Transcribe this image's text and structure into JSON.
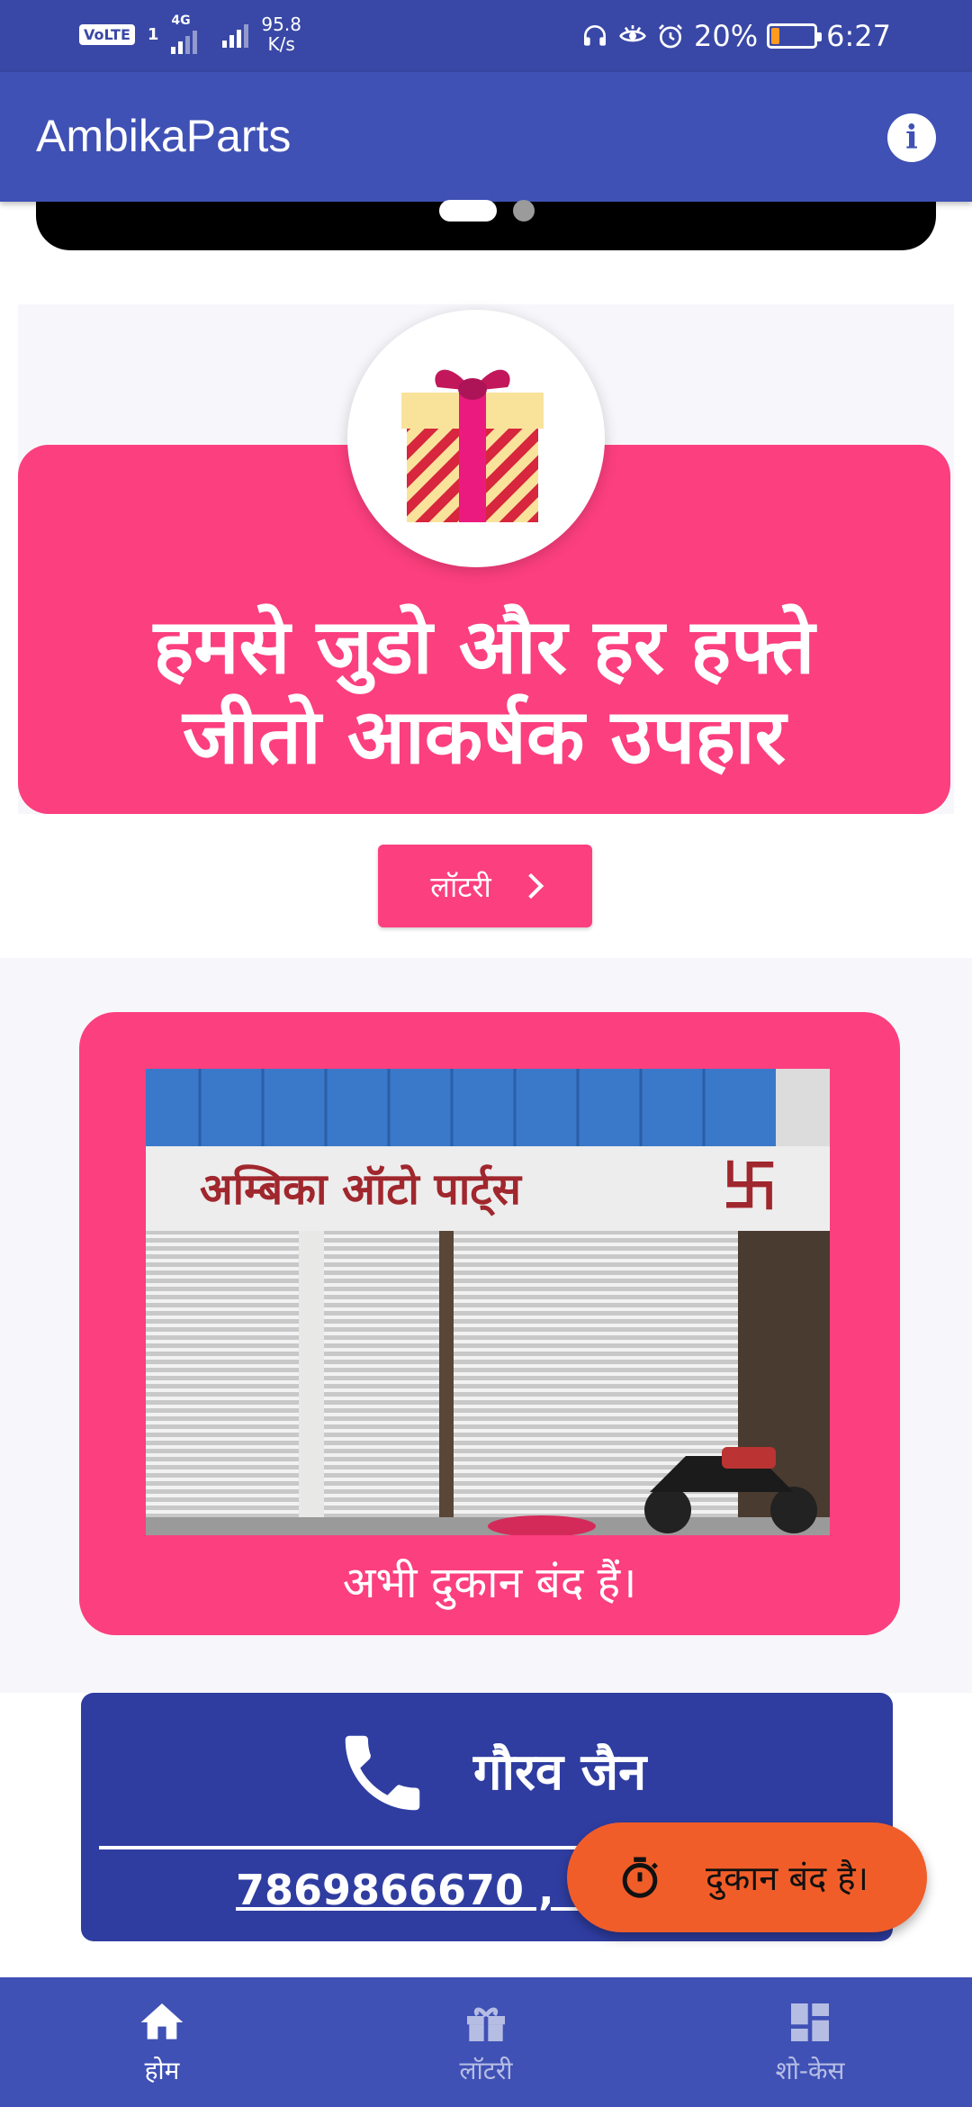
{
  "status_bar": {
    "volte": "VoLTE",
    "sim_slot": "1",
    "network": "4G",
    "speed_value": "95.8",
    "speed_unit": "K/s",
    "battery": "20%",
    "battery_level": 0.2,
    "time": "6:27"
  },
  "app_bar": {
    "title": "AmbikaParts",
    "info_icon": "info-icon",
    "info_glyph": "i"
  },
  "carousel": {
    "slide_count": 2,
    "active_index": 0
  },
  "gift_banner": {
    "line1": "हमसे जुडो और हर हफ्ते",
    "line2": "जीतो आकर्षक उपहार",
    "icon": "gift-icon"
  },
  "lottery_button": {
    "label": "लॉटरी"
  },
  "shop_card": {
    "sign_text": "अम्बिका ऑटो पार्ट्स",
    "caption": "अभी दुकान बंद हैं।"
  },
  "contact": {
    "name": "गौरव जैन",
    "phones": "7869866670 , 881"
  },
  "fab": {
    "label": "दुकान बंद है।",
    "icon": "timer-icon"
  },
  "bottom_nav": {
    "items": [
      {
        "label": "होम",
        "icon": "home-icon",
        "active": true
      },
      {
        "label": "लॉटरी",
        "icon": "gift-icon",
        "active": false
      },
      {
        "label": "शो-केस",
        "icon": "dashboard-icon",
        "active": false
      }
    ]
  },
  "colors": {
    "primary": "#3f51b5",
    "status_bar": "#3948a6",
    "accent_pink": "#fc3f7e",
    "fab_orange": "#f15d29",
    "contact_blue": "#2f3da1"
  }
}
